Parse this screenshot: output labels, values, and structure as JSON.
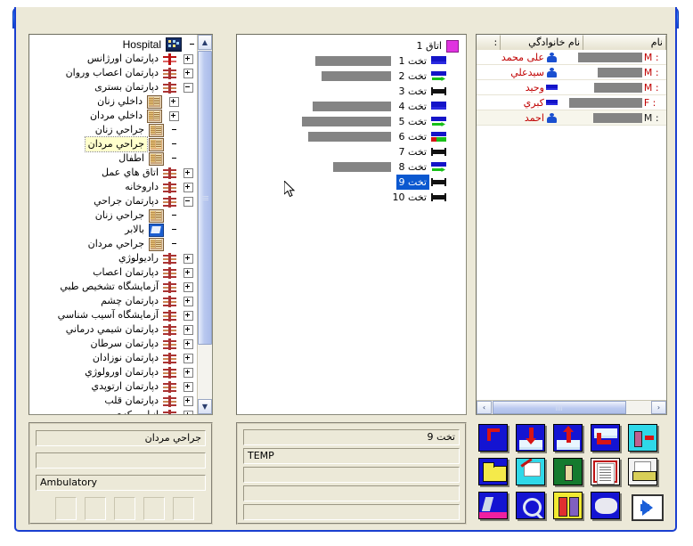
{
  "window": {
    "title": "",
    "buttons": {
      "minimize": "_",
      "maximize": "❐",
      "close": "✕"
    }
  },
  "tree": {
    "root": {
      "label": "Hospital",
      "icon": "hospital-building-icon"
    },
    "nodes": [
      {
        "label": "دپارتمان  اورژانس",
        "icon": "emergency-icon",
        "expander": "plus",
        "level": 1
      },
      {
        "label": "دپارتمان اعصاب وروان",
        "icon": "department-icon",
        "expander": "plus",
        "level": 1
      },
      {
        "label": "دپارتمان بستری",
        "icon": "department-icon",
        "expander": "minus",
        "level": 1
      },
      {
        "label": "داخلي زنان",
        "icon": "ward-icon",
        "expander": "plus",
        "level": 2
      },
      {
        "label": "داخلي مردان",
        "icon": "ward-icon",
        "expander": "plus",
        "level": 2
      },
      {
        "label": "جراحي زنان",
        "icon": "ward-icon",
        "expander": "none",
        "level": 2
      },
      {
        "label": "جراحي مردان",
        "icon": "ward-icon",
        "expander": "none",
        "level": 2,
        "selected": true
      },
      {
        "label": "اطفال",
        "icon": "ward-icon",
        "expander": "none",
        "level": 2
      },
      {
        "label": "اتاق هاي عمل",
        "icon": "department-icon",
        "expander": "plus",
        "level": 1
      },
      {
        "label": "داروخانه",
        "icon": "department-icon",
        "expander": "plus",
        "level": 1
      },
      {
        "label": "دپارتمان جراحي",
        "icon": "department-icon",
        "expander": "minus",
        "level": 1
      },
      {
        "label": "جراحي زنان",
        "icon": "ward-icon",
        "expander": "none",
        "level": 2
      },
      {
        "label": "بالابر",
        "icon": "lift-icon",
        "expander": "none",
        "level": 2
      },
      {
        "label": "جراحي مردان",
        "icon": "ward-icon",
        "expander": "none",
        "level": 2
      },
      {
        "label": "راديولوژي",
        "icon": "department-icon",
        "expander": "plus",
        "level": 1
      },
      {
        "label": "دپارتمان اعصاب",
        "icon": "department-icon",
        "expander": "plus",
        "level": 1
      },
      {
        "label": "آزمايشگاه تشخيص طبي",
        "icon": "department-icon",
        "expander": "plus",
        "level": 1
      },
      {
        "label": "دپارتمان چشم",
        "icon": "department-icon",
        "expander": "plus",
        "level": 1
      },
      {
        "label": "آزمايشگاه آسيب شناسي",
        "icon": "department-icon",
        "expander": "plus",
        "level": 1
      },
      {
        "label": "دپارتمان شيمي درماني",
        "icon": "department-icon",
        "expander": "plus",
        "level": 1
      },
      {
        "label": "دپارتمان سرطان",
        "icon": "department-icon",
        "expander": "plus",
        "level": 1
      },
      {
        "label": "دپارتمان نوزادان",
        "icon": "department-icon",
        "expander": "plus",
        "level": 1
      },
      {
        "label": "دپارتمان اورولوژي",
        "icon": "department-icon",
        "expander": "plus",
        "level": 1
      },
      {
        "label": "دپارتمان ارتوپدي",
        "icon": "department-icon",
        "expander": "plus",
        "level": 1
      },
      {
        "label": "دپارتمان قلب",
        "icon": "department-icon",
        "expander": "plus",
        "level": 1
      },
      {
        "label": "انبارمرکزي",
        "icon": "department-icon",
        "expander": "plus",
        "level": 1
      }
    ],
    "scrollbar": {
      "up": "▲",
      "down": "▼"
    }
  },
  "beds": {
    "room": {
      "label": "اتاق 1",
      "icon": "room-icon"
    },
    "items": [
      {
        "label": "تخت 1",
        "icon": "bed-occupied-icon",
        "redacted_width": 85,
        "selected": false
      },
      {
        "label": "تخت 2",
        "icon": "bed-discharge-icon",
        "redacted_width": 78,
        "selected": false
      },
      {
        "label": "تخت 3",
        "icon": "bed-empty-icon",
        "redacted_width": 0,
        "selected": false
      },
      {
        "label": "تخت 4",
        "icon": "bed-occupied-icon",
        "redacted_width": 88,
        "selected": false
      },
      {
        "label": "تخت 5",
        "icon": "bed-discharge-icon",
        "redacted_width": 100,
        "selected": false
      },
      {
        "label": "تخت 6",
        "icon": "bed-reserved-icon",
        "redacted_width": 93,
        "selected": false
      },
      {
        "label": "تخت 7",
        "icon": "bed-empty-icon",
        "redacted_width": 0,
        "selected": false
      },
      {
        "label": "تخت 8",
        "icon": "bed-discharge-icon",
        "redacted_width": 65,
        "selected": false
      },
      {
        "label": "تخت 9",
        "icon": "bed-empty-icon",
        "redacted_width": 0,
        "selected": true
      },
      {
        "label": "تخت 10",
        "icon": "bed-empty-icon",
        "redacted_width": 0,
        "selected": false
      }
    ]
  },
  "grid": {
    "columns": [
      {
        "key": "name",
        "label": "نام",
        "width": 96
      },
      {
        "key": "family",
        "label": "نام خانوادگي",
        "width": 96
      },
      {
        "key": "sex",
        "label": ":",
        "width": 28
      }
    ],
    "rows": [
      {
        "name": "علی محمد",
        "icon": "patient-person-icon",
        "family_redacted_width": 72,
        "sex": "M :",
        "sex_dark": false,
        "alt": false
      },
      {
        "name": "سيدعلي",
        "icon": "patient-person-icon",
        "family_redacted_width": 50,
        "sex": "M :",
        "sex_dark": false,
        "alt": false
      },
      {
        "name": "وحيد",
        "icon": "patient-bed-icon",
        "family_redacted_width": 54,
        "sex": "M :",
        "sex_dark": false,
        "alt": false
      },
      {
        "name": "کبري",
        "icon": "patient-bed-icon",
        "family_redacted_width": 82,
        "sex": "F :",
        "sex_dark": false,
        "alt": false
      },
      {
        "name": "احمد",
        "icon": "patient-person-icon",
        "family_redacted_width": 55,
        "sex": "M :",
        "sex_dark": true,
        "alt": true
      }
    ],
    "hscroll": {
      "left": "‹",
      "right": "›"
    }
  },
  "bottom_left": {
    "fields": [
      {
        "value": "جراحي مردان",
        "dir": "rtl"
      },
      {
        "value": "",
        "dir": "rtl"
      },
      {
        "value": "Ambulatory",
        "dir": "ltr"
      }
    ],
    "boxes": [
      "",
      "",
      "",
      "",
      ""
    ]
  },
  "bottom_middle": {
    "fields": [
      {
        "value": "تخت 9",
        "dir": "rtl"
      },
      {
        "value": "TEMP",
        "dir": "ltr"
      },
      {
        "value": "",
        "dir": "rtl"
      },
      {
        "value": "",
        "dir": "rtl"
      },
      {
        "value": "",
        "dir": "rtl"
      }
    ]
  },
  "toolbar": {
    "buttons": [
      {
        "name": "admit-hook-icon",
        "row": 0,
        "col": 0
      },
      {
        "name": "admit-to-bed-icon",
        "row": 0,
        "col": 1
      },
      {
        "name": "discharge-from-bed-icon",
        "row": 0,
        "col": 2
      },
      {
        "name": "bed-transfer-icon",
        "row": 0,
        "col": 3
      },
      {
        "name": "patient-move-icon",
        "row": 0,
        "col": 4
      },
      {
        "name": "folder-icon",
        "row": 1,
        "col": 0
      },
      {
        "name": "write-note-icon",
        "row": 1,
        "col": 1
      },
      {
        "name": "operation-icon",
        "row": 1,
        "col": 2
      },
      {
        "name": "report-icon",
        "row": 1,
        "col": 3
      },
      {
        "name": "archive-icon",
        "row": 1,
        "col": 4
      },
      {
        "name": "laboratory-icon",
        "row": 2,
        "col": 0
      },
      {
        "name": "search-icon",
        "row": 2,
        "col": 1
      },
      {
        "name": "pharmacy-icon",
        "row": 2,
        "col": 2
      },
      {
        "name": "pathology-icon",
        "row": 2,
        "col": 3
      }
    ],
    "go_button": {
      "name": "go-next-button",
      "glyph": "➡"
    }
  },
  "colors": {
    "titlebar_blue": "#1a64f0",
    "window_face": "#ece9d8",
    "selection_blue": "#0a58d0",
    "tree_selection": "#ffffcc",
    "patient_name_red": "#c00000",
    "redaction_gray": "#848484"
  }
}
